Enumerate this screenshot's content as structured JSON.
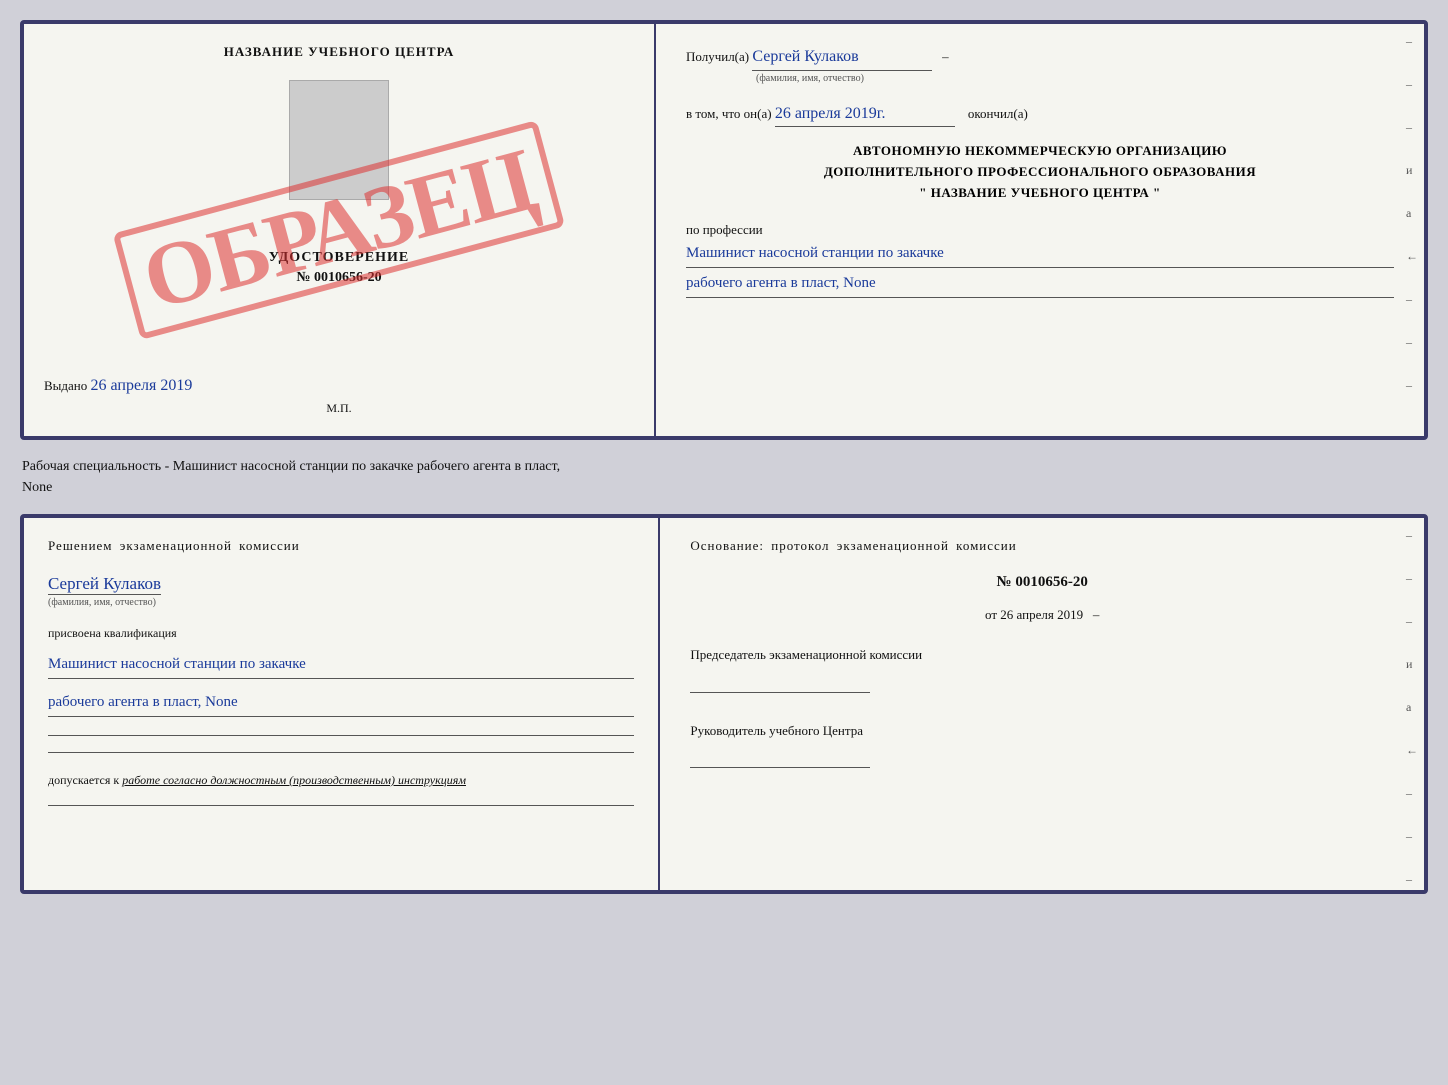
{
  "top_left": {
    "center_title": "НАЗВАНИЕ УЧЕБНОГО ЦЕНТРА",
    "stamp_text": "ОБРАЗЕЦ",
    "cert_title": "УДОСТОВЕРЕНИЕ",
    "cert_number": "№ 0010656-20",
    "issued_label": "Выдано",
    "issued_date": "26 апреля 2019",
    "mp_label": "М.П."
  },
  "top_right": {
    "received_label": "Получил(а)",
    "received_name": "Сергей Кулаков",
    "received_subtext": "(фамилия, имя, отчество)",
    "date_label": "в том, что он(а)",
    "date_value": "26 апреля 2019г.",
    "finished_label": "окончил(а)",
    "org_line1": "АВТОНОМНУЮ НЕКОММЕРЧЕСКУЮ ОРГАНИЗАЦИЮ",
    "org_line2": "ДОПОЛНИТЕЛЬНОГО ПРОФЕССИОНАЛЬНОГО ОБРАЗОВАНИЯ",
    "org_line3": "\" НАЗВАНИЕ УЧЕБНОГО ЦЕНТРА \"",
    "profession_label": "по профессии",
    "profession_line1": "Машинист насосной станции по закачке",
    "profession_line2": "рабочего агента в пласт, None",
    "side_dashes": [
      "-",
      "-",
      "-",
      "и",
      "а",
      "←",
      "-",
      "-",
      "-"
    ]
  },
  "between": {
    "text_line1": "Рабочая специальность - Машинист насосной станции по закачке рабочего агента в пласт,",
    "text_line2": "None"
  },
  "bottom_left": {
    "commission_text": "Решением экзаменационной комиссии",
    "person_name": "Сергей Кулаков",
    "person_subtext": "(фамилия, имя, отчество)",
    "qualification_label": "присвоена квалификация",
    "qualification_line1": "Машинист насосной станции по закачке",
    "qualification_line2": "рабочего агента в пласт, None",
    "admits_prefix": "допускается к",
    "admits_italic": "работе согласно должностным (производственным) инструкциям"
  },
  "bottom_right": {
    "basis_label": "Основание: протокол экзаменационной комиссии",
    "protocol_number": "№ 0010656-20",
    "protocol_date_prefix": "от",
    "protocol_date": "26 апреля 2019",
    "chairman_label": "Председатель экзаменационной комиссии",
    "head_label": "Руководитель учебного Центра",
    "side_dashes": [
      "-",
      "-",
      "-",
      "и",
      "а",
      "←",
      "-",
      "-",
      "-"
    ]
  }
}
